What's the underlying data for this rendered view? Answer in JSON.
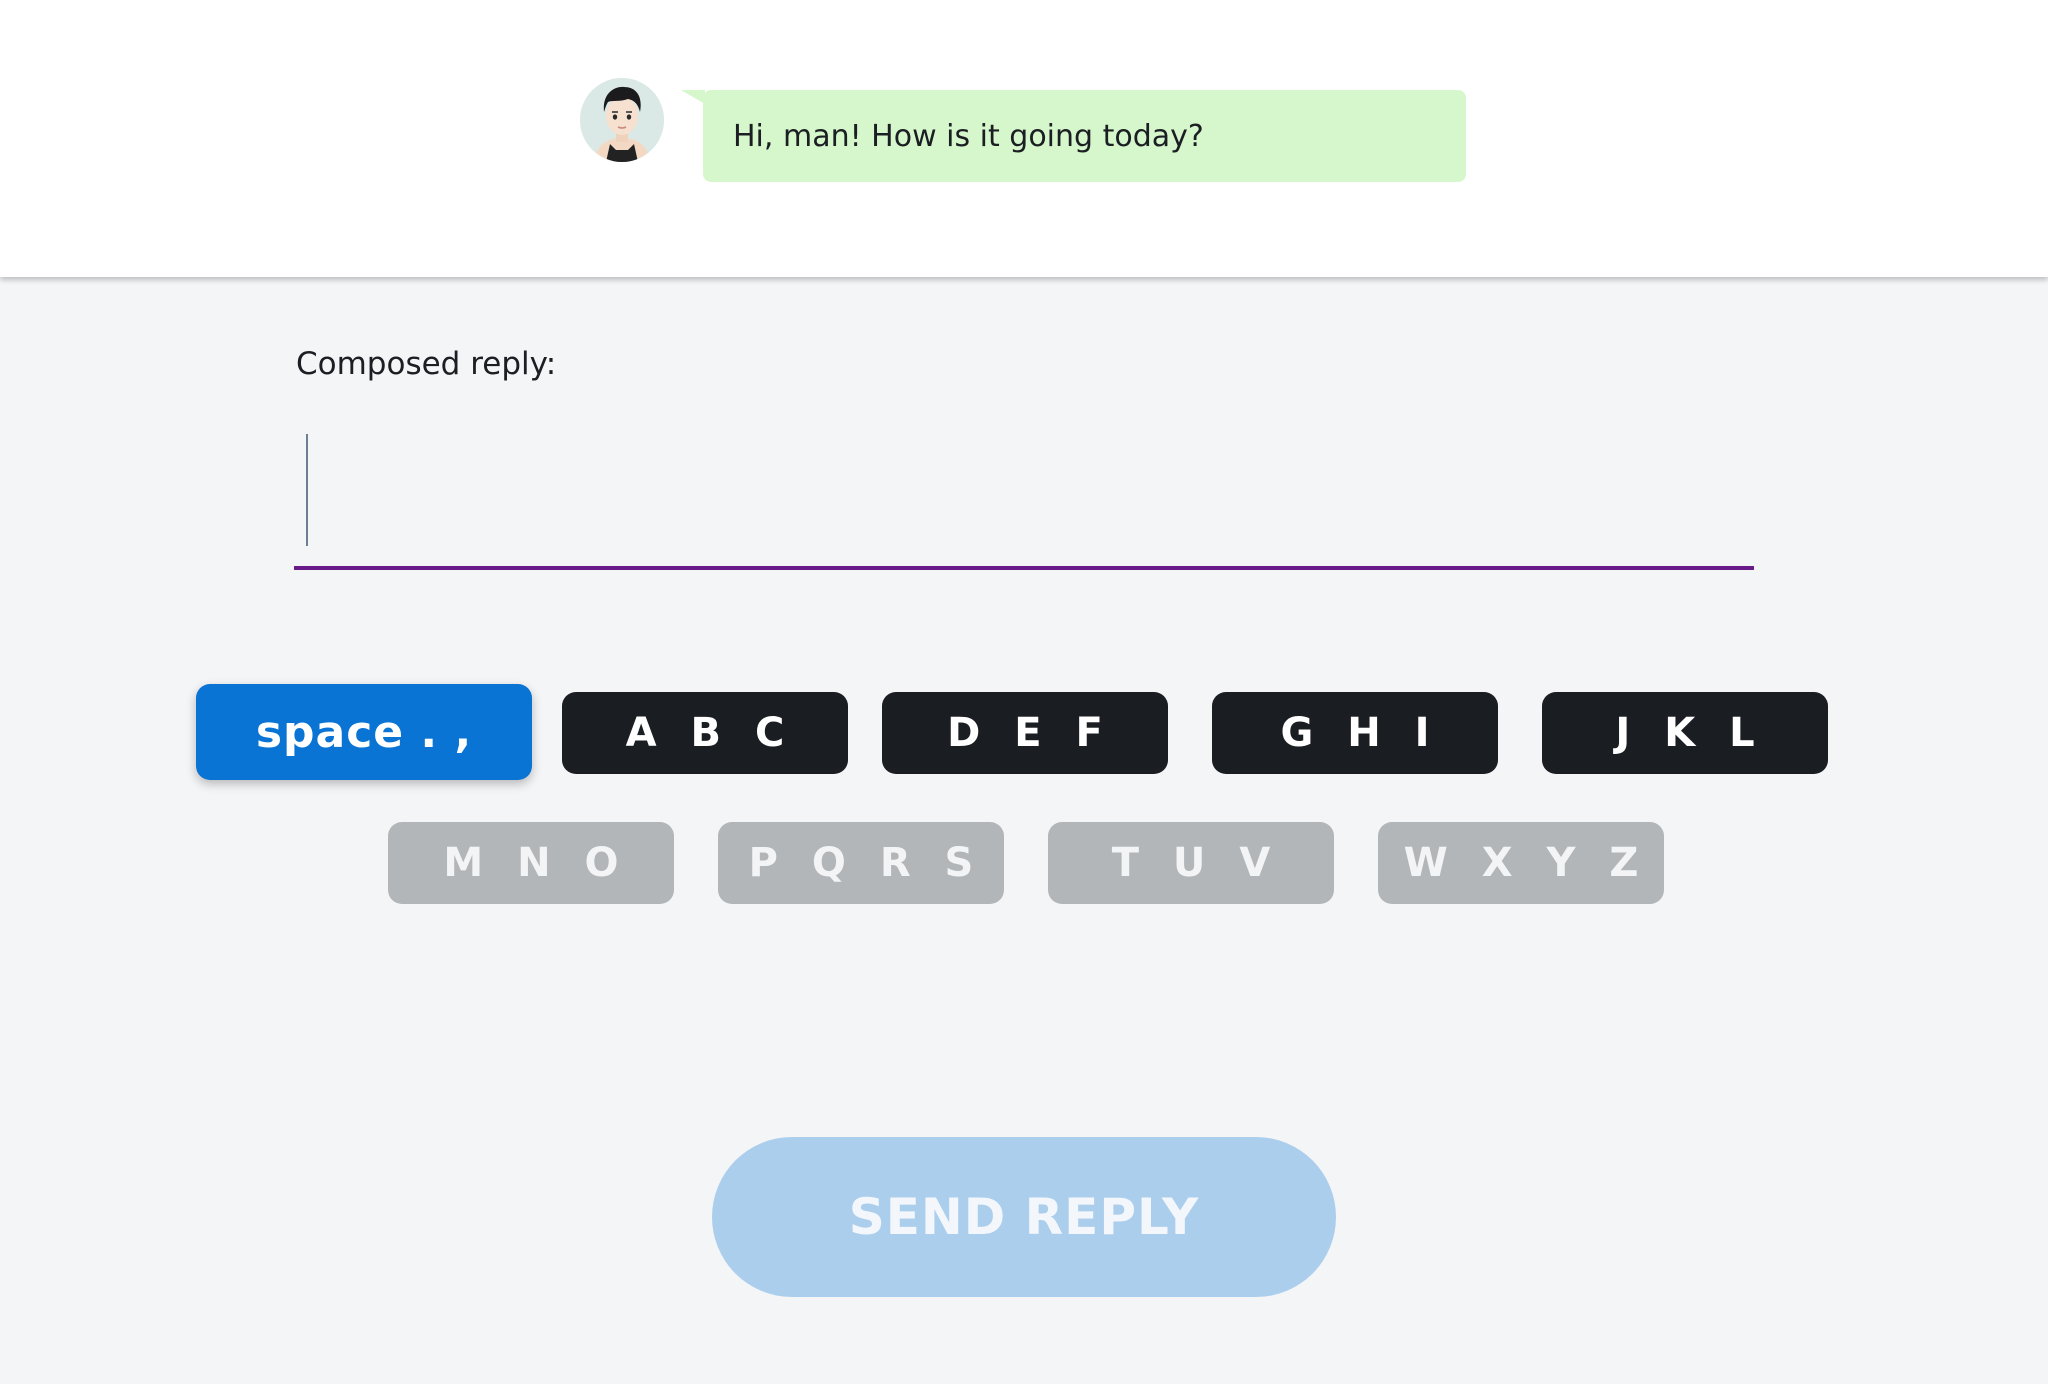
{
  "chat": {
    "message": "Hi, man! How is it going today?",
    "avatar_icon": "male-avatar-icon"
  },
  "compose": {
    "label": "Composed reply:",
    "value": ""
  },
  "keypad": {
    "row1": [
      "space . ,",
      "A B C",
      "D E F",
      "G H I",
      "J K L"
    ],
    "row2": [
      "M N O",
      "P Q R S",
      "T U V",
      "W X Y Z"
    ],
    "active_key": "space . ,"
  },
  "send": {
    "label": "SEND REPLY",
    "enabled": false
  },
  "colors": {
    "bubble": "#d6f7cb",
    "active_key": "#0a74d4",
    "enabled_key": "#1a1d21",
    "disabled_key": "#b3b6b9",
    "field_underline": "#6a1b8a",
    "send_disabled": "#acceed"
  }
}
